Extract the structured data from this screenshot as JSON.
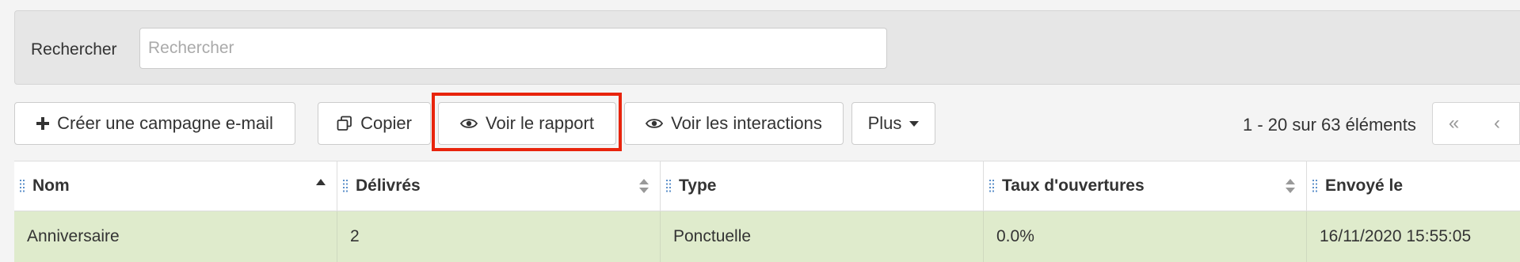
{
  "search": {
    "label": "Rechercher",
    "placeholder": "Rechercher"
  },
  "toolbar": {
    "create_label": "Créer une campagne e-mail",
    "copy_label": "Copier",
    "report_label": "Voir le rapport",
    "interactions_label": "Voir les interactions",
    "more_label": "Plus"
  },
  "pager": {
    "summary": "1 - 20 sur 63 éléments",
    "first_symbol": "«",
    "prev_symbol": "‹"
  },
  "table": {
    "columns": [
      "Nom",
      "Délivrés",
      "Type",
      "Taux d'ouvertures",
      "Envoyé le"
    ],
    "rows": [
      [
        "Anniversaire",
        "2",
        "Ponctuelle",
        "0.0%",
        "16/11/2020 15:55:05"
      ]
    ]
  },
  "colors": {
    "highlight": "#e8240c",
    "selected_row": "#dfebcc"
  },
  "icons": {
    "create": "plus-icon",
    "copy": "copy-icon",
    "report": "eye-icon",
    "interactions": "eye-icon",
    "more": "caret-down-icon",
    "column_grip": "grip-icon",
    "sort_asc": "sort-asc-icon",
    "sortable": "sort-icon"
  }
}
